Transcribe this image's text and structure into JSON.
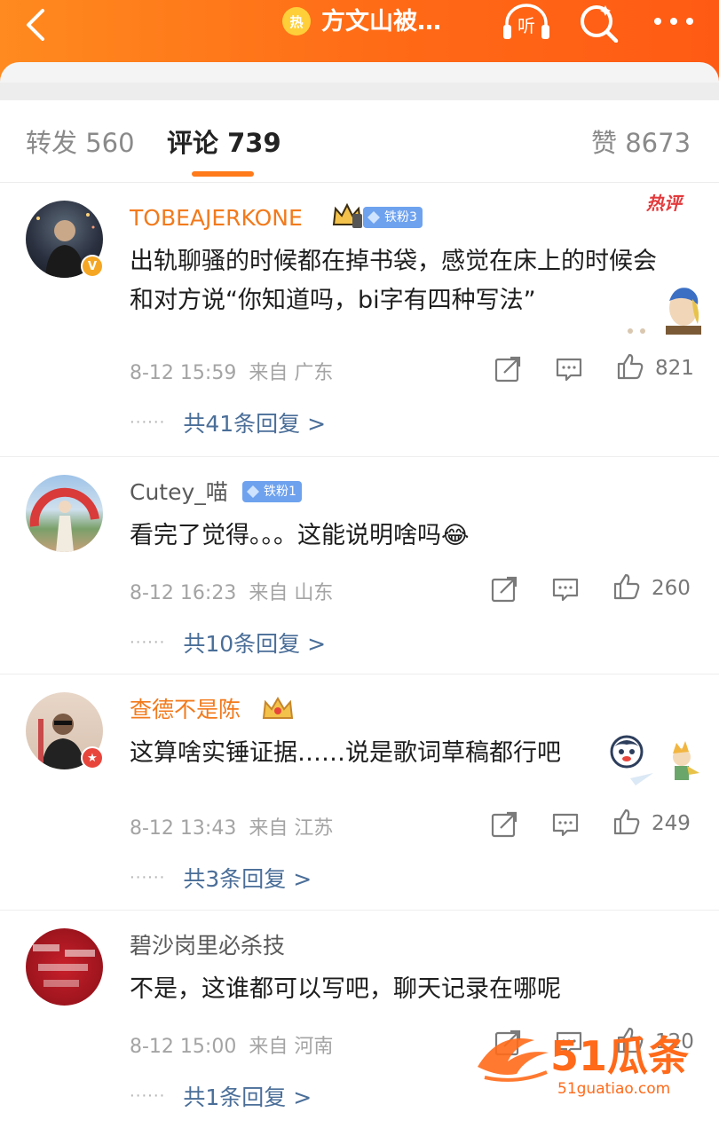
{
  "header": {
    "hot_badge": "热",
    "title": "方文山被…",
    "listen_label": "听",
    "colors": {
      "header_orange": "#ff6a16",
      "accent": "#ff7a1a",
      "link": "#4a6e98"
    }
  },
  "tabs": [
    {
      "label": "转发 560"
    },
    {
      "label": "评论 739"
    },
    {
      "label": "赞 8673"
    }
  ],
  "comments": [
    {
      "username": "TOBEAJERKONE",
      "fan_badge": "铁粉3",
      "hot_label": "热评",
      "text": "出轨聊骚的时候都在掉书袋，感觉在床上的时候会和对方说“你知道吗，bi字有四种写法”",
      "time": "8-12 15:59",
      "location": "来自 广东",
      "likes": "821",
      "replies": "共41条回复 >"
    },
    {
      "username": "Cutey_喵",
      "fan_badge": "铁粉1",
      "text": "看完了觉得。。。这能说明啥吗",
      "emoji": "😂",
      "time": "8-12 16:23",
      "location": "来自 山东",
      "likes": "260",
      "replies": "共10条回复 >"
    },
    {
      "username": "查德不是陈",
      "text": "这算啥实锤证据……说是歌词草稿都行吧",
      "time": "8-12 13:43",
      "location": "来自 江苏",
      "likes": "249",
      "replies": "共3条回复 >"
    },
    {
      "username": "碧沙岗里必杀技",
      "text": "不是，这谁都可以写吧，聊天记录在哪呢",
      "time": "8-12 15:00",
      "location": "来自 河南",
      "likes": "120",
      "replies": "共1条回复 >"
    }
  ],
  "watermark": {
    "brand": "51瓜条",
    "url": "51guatiao.com"
  }
}
